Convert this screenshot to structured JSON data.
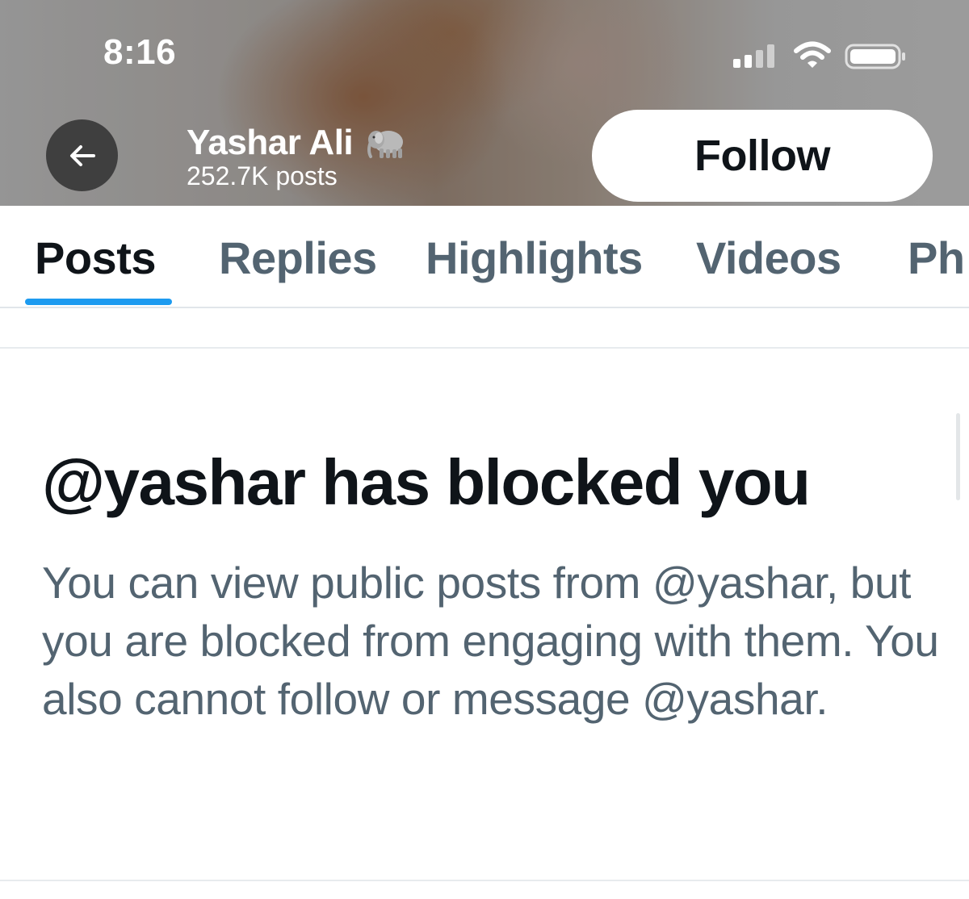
{
  "status_bar": {
    "time": "8:16",
    "icons": [
      "cellular-signal-icon",
      "wifi-icon",
      "battery-icon"
    ]
  },
  "header": {
    "back_icon": "arrow-left-icon",
    "profile_name": "Yashar Ali",
    "name_emoji_icon": "elephant-icon",
    "post_count": "252.7K posts",
    "follow_label": "Follow"
  },
  "tabs": [
    {
      "label": "Posts",
      "active": true
    },
    {
      "label": "Replies",
      "active": false
    },
    {
      "label": "Highlights",
      "active": false
    },
    {
      "label": "Videos",
      "active": false
    },
    {
      "label": "Ph",
      "active": false
    }
  ],
  "blocked": {
    "title": "@yashar has blocked you",
    "message": "You can view public posts from @yashar, but you are blocked from engaging with them. You also cannot follow or message @yashar."
  },
  "colors": {
    "accent": "#1d9bf0",
    "primary_text": "#0f1419",
    "secondary_text": "#536471"
  }
}
